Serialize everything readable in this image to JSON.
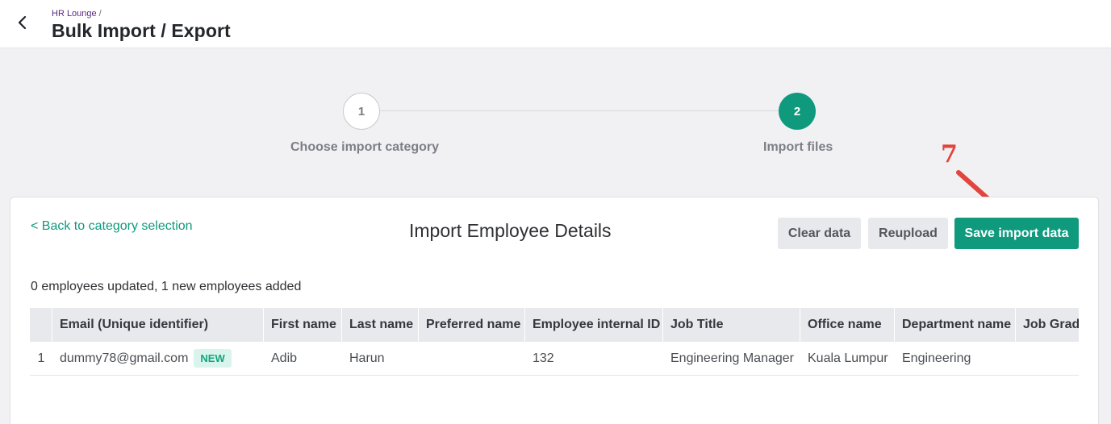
{
  "header": {
    "breadcrumb": "HR Lounge",
    "breadcrumb_sep": "/",
    "title": "Bulk Import / Export",
    "back_icon": "chevron-left-icon"
  },
  "stepper": {
    "steps": [
      {
        "number": "1",
        "label": "Choose import category",
        "state": "done"
      },
      {
        "number": "2",
        "label": "Import files",
        "state": "active"
      }
    ],
    "active_color": "#0f9a7e"
  },
  "annotation": {
    "number": "7",
    "color": "#e1453d"
  },
  "card": {
    "back_link": "< Back to category selection",
    "title": "Import Employee Details",
    "buttons": {
      "clear": "Clear data",
      "reupload": "Reupload",
      "save": "Save import data"
    },
    "summary": "0 employees updated, 1 new employees added"
  },
  "table": {
    "columns": [
      "Email (Unique identifier)",
      "First name",
      "Last name",
      "Preferred name",
      "Employee internal ID",
      "Job Title",
      "Office name",
      "Department name",
      "Job Grade"
    ],
    "rows": [
      {
        "index": "1",
        "email": "dummy78@gmail.com",
        "badge": "NEW",
        "first_name": "Adib",
        "last_name": "Harun",
        "preferred_name": "",
        "employee_id": "132",
        "job_title": "Engineering Manager",
        "office": "Kuala Lumpur",
        "department": "Engineering",
        "job_grade": ""
      }
    ]
  },
  "colors": {
    "accent": "#0f9a7e",
    "badge_bg": "#d9f4ec",
    "page_bg": "#f1f1f3"
  }
}
